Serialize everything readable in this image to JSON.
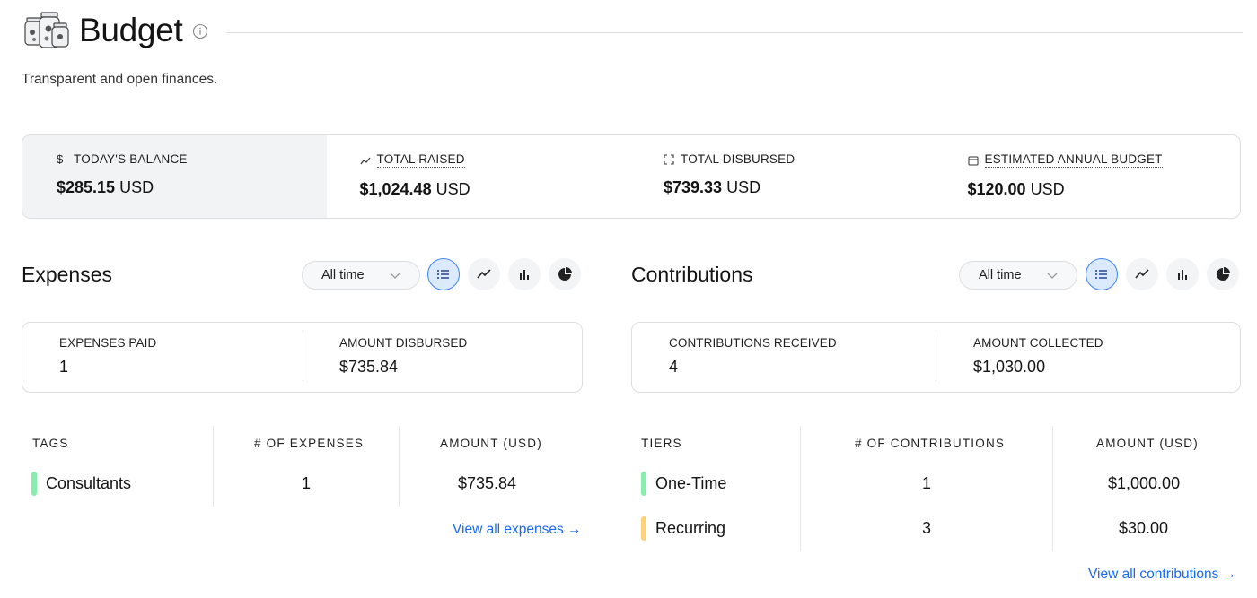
{
  "header": {
    "title": "Budget",
    "subtitle": "Transparent and open finances."
  },
  "stats": [
    {
      "label": "TODAY'S BALANCE",
      "amount": "$285.15",
      "currency": "USD",
      "icon": "dollar-icon"
    },
    {
      "label": "TOTAL RAISED",
      "amount": "$1,024.48",
      "currency": "USD",
      "icon": "trend-up-icon"
    },
    {
      "label": "TOTAL DISBURSED",
      "amount": "$739.33",
      "currency": "USD",
      "icon": "expand-arrows-icon"
    },
    {
      "label": "ESTIMATED ANNUAL BUDGET",
      "amount": "$120.00",
      "currency": "USD",
      "icon": "calendar-icon"
    }
  ],
  "expenses": {
    "title": "Expenses",
    "period": "All time",
    "summary": {
      "paid_label": "EXPENSES PAID",
      "paid_value": "1",
      "disbursed_label": "AMOUNT DISBURSED",
      "disbursed_value": "$735.84"
    },
    "columns": [
      "TAGS",
      "# OF EXPENSES",
      "AMOUNT (USD)"
    ],
    "rows": [
      {
        "name": "Consultants",
        "count": "1",
        "amount": "$735.84",
        "color": "#86efac"
      }
    ],
    "link": "View all expenses →"
  },
  "contributions": {
    "title": "Contributions",
    "period": "All time",
    "summary": {
      "received_label": "CONTRIBUTIONS RECEIVED",
      "received_value": "4",
      "collected_label": "AMOUNT COLLECTED",
      "collected_value": "$1,030.00"
    },
    "columns": [
      "TIERS",
      "# OF CONTRIBUTIONS",
      "AMOUNT (USD)"
    ],
    "rows": [
      {
        "name": "One-Time",
        "count": "1",
        "amount": "$1,000.00",
        "color": "#86efac"
      },
      {
        "name": "Recurring",
        "count": "3",
        "amount": "$30.00",
        "color": "#fcd27a"
      }
    ],
    "link": "View all contributions →"
  },
  "view_buttons": [
    "list-view-icon",
    "line-chart-icon",
    "bar-chart-icon",
    "pie-chart-icon"
  ],
  "colors": {
    "accent": "#3b82f6",
    "link": "#1869f5",
    "border": "#dcdee0"
  }
}
